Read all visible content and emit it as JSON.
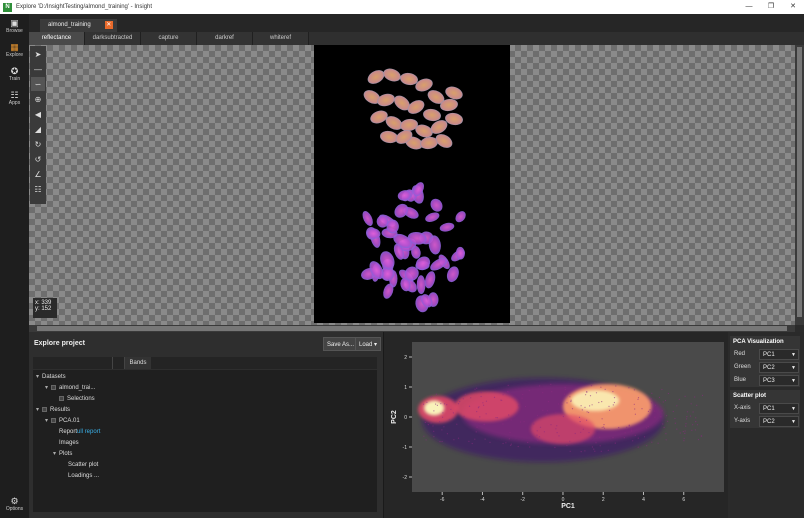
{
  "window": {
    "title": "Explore 'D:/InsightTesting/almond_training' - Insight",
    "app_logo": "N"
  },
  "nav": {
    "items": [
      {
        "label": "Browse",
        "icon": "folder-icon"
      },
      {
        "label": "Explore",
        "icon": "explore-icon"
      },
      {
        "label": "Train",
        "icon": "run-icon"
      },
      {
        "label": "Apps",
        "icon": "grid-icon"
      }
    ],
    "options": {
      "label": "Options",
      "icon": "gear-icon"
    }
  },
  "file_tab": {
    "label": "almond_training"
  },
  "sub_tabs": [
    "reflectance",
    "darksubtracted",
    "capture",
    "darkref",
    "whiteref"
  ],
  "viewer": {
    "coords": {
      "x": "x: 339",
      "y": "y: 152"
    }
  },
  "explore": {
    "title": "Explore project",
    "save_label": "Save As...",
    "load_label": "Load",
    "bands_label": "Bands",
    "tree": {
      "datasets": "Datasets",
      "dataset_item": "almond_trai...",
      "selections": "Selections",
      "results": "Results",
      "pca": "PCA.01",
      "report_prefix": "Report",
      "report_link": "ull report",
      "images": "Images",
      "plots": "Plots",
      "scatter": "Scatter plot",
      "loadings": "Loadings ..."
    }
  },
  "pca_panel": {
    "viz_title": "PCA Visualization",
    "red_label": "Red",
    "red_value": "PC1",
    "green_label": "Green",
    "green_value": "PC2",
    "blue_label": "Blue",
    "blue_value": "PC3",
    "scatter_title": "Scatter plot",
    "xaxis_label": "X-axis",
    "xaxis_value": "PC1",
    "yaxis_label": "Y-axis",
    "yaxis_value": "PC2"
  },
  "chart_data": {
    "type": "heatmap",
    "xlabel": "PC1",
    "ylabel": "PC2",
    "xlim": [
      -7.5,
      8
    ],
    "ylim": [
      -2.5,
      2.5
    ],
    "x_ticks": [
      -6,
      -4,
      -2,
      0,
      2,
      4,
      6
    ],
    "y_ticks": [
      2,
      1,
      0,
      -1,
      -2
    ],
    "density_colors": [
      "#3b0f70",
      "#8c2981",
      "#de4968",
      "#fe9f6d",
      "#fcfdbf"
    ]
  }
}
